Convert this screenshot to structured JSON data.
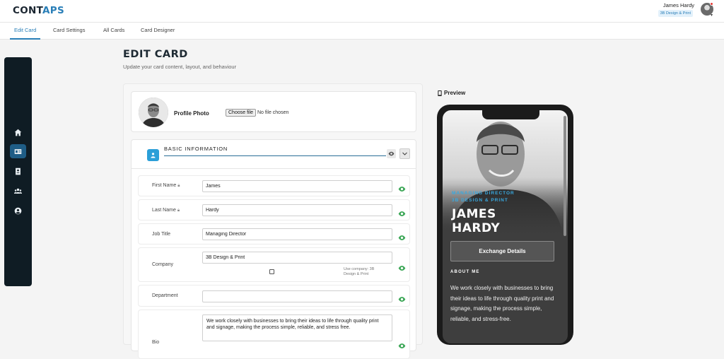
{
  "app": {
    "logo_main": "CONT",
    "logo_accent": "APS"
  },
  "user": {
    "name": "James Hardy",
    "company": "3B Design & Print"
  },
  "tabs": [
    {
      "label": "Edit Card",
      "active": true
    },
    {
      "label": "Card Settings",
      "active": false
    },
    {
      "label": "All Cards",
      "active": false
    },
    {
      "label": "Card Designer",
      "active": false
    }
  ],
  "sidebar": {
    "items": [
      {
        "icon": "home-icon",
        "active": false
      },
      {
        "icon": "id-card-icon",
        "active": true
      },
      {
        "icon": "contact-book-icon",
        "active": false
      },
      {
        "icon": "users-icon",
        "active": false
      },
      {
        "icon": "user-circle-icon",
        "active": false
      }
    ]
  },
  "page": {
    "title": "EDIT CARD",
    "subtitle": "Update your card content, layout, and behaviour"
  },
  "photo": {
    "label": "Profile Photo",
    "button": "Choose file",
    "status": "No file chosen"
  },
  "section": {
    "title": "BASIC INFORMATION",
    "icon": "id-card-icon"
  },
  "fields": {
    "first_name": {
      "label": "First Name",
      "value": "James",
      "locked": true
    },
    "last_name": {
      "label": "Last Name",
      "value": "Hardy",
      "locked": true
    },
    "job_title": {
      "label": "Job Title",
      "value": "Managing Director"
    },
    "company": {
      "label": "Company",
      "value": "3B Design & Print",
      "checkbox_hint": "Use company: 3B Design & Print",
      "checkbox_checked": false
    },
    "department": {
      "label": "Department",
      "value": ""
    },
    "bio": {
      "label": "Bio",
      "value": "We work closely with businesses to bring their ideas to life through quality print and signage, making the process simple, reliable, and stress free."
    }
  },
  "preview": {
    "title": "Preview",
    "role": "MANAGING DIRECTOR",
    "company": "3B DESIGN & PRINT",
    "first_name": "JAMES",
    "last_name": "HARDY",
    "button": "Exchange Details",
    "about_heading": "ABOUT ME",
    "bio": "We work closely with businesses to bring their ideas to life through quality print and signage, making the process simple, reliable, and stress-free."
  },
  "colors": {
    "accent": "#2a7fb8",
    "sidebar_bg": "#0f1c24",
    "sidebar_active": "#1f5d86",
    "visible_eye": "#3aa655",
    "preview_accent": "#39a9e0"
  }
}
